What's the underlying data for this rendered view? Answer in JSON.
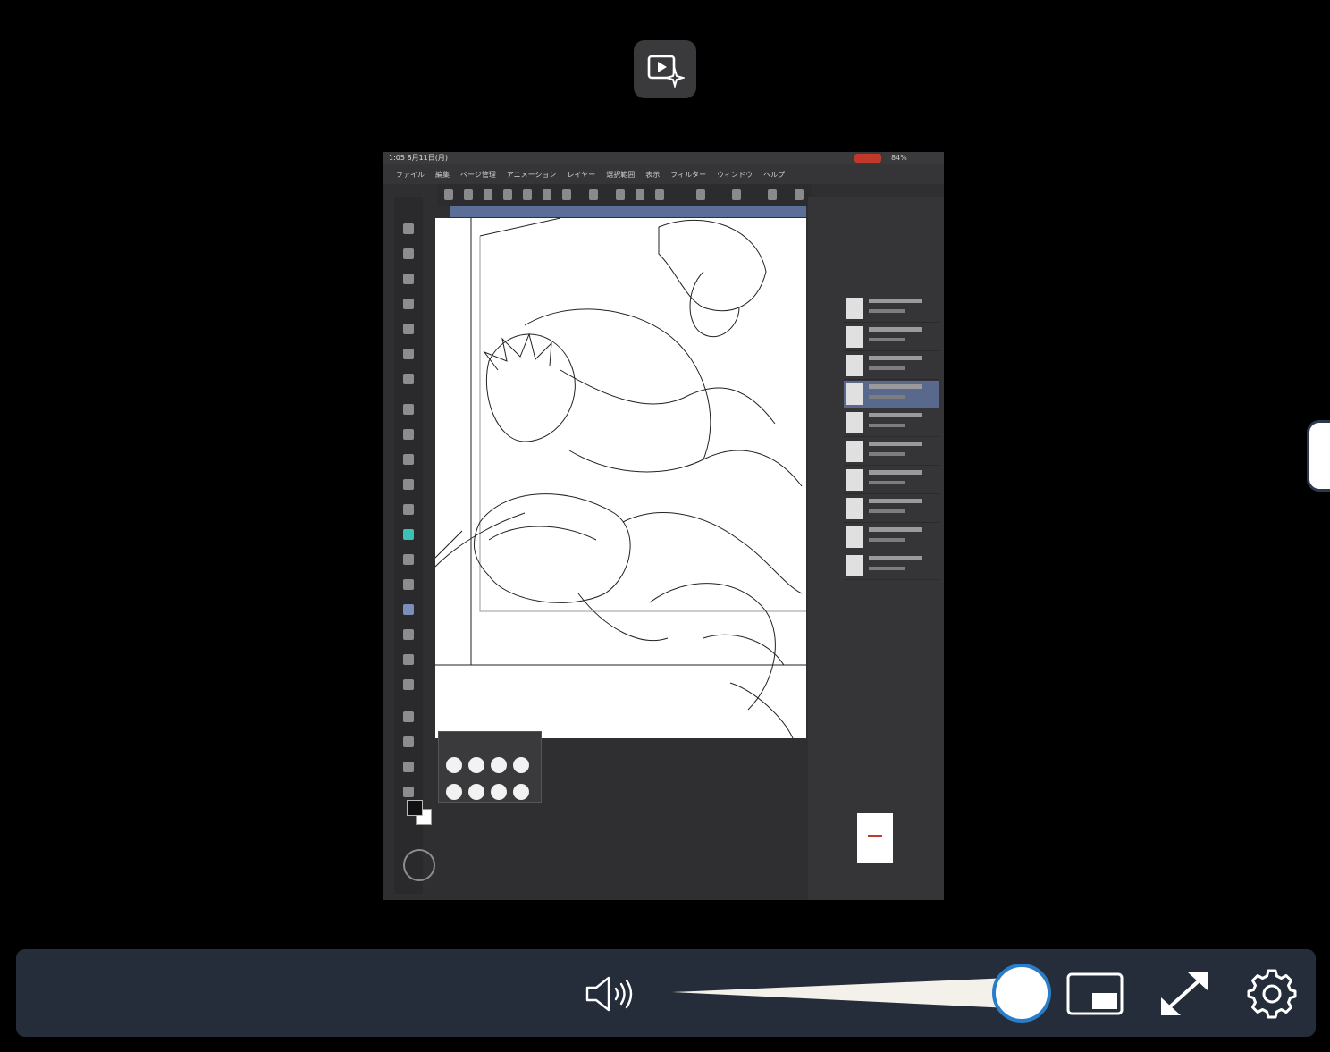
{
  "player": {
    "badge_icon": "ai-video-icon",
    "video": {
      "status_time": "1:05 8月11日(月)",
      "battery_text": "84%",
      "menu": [
        "ファイル",
        "編集",
        "ページ管理",
        "アニメーション",
        "レイヤー",
        "選択範囲",
        "表示",
        "フィルター",
        "ウィンドウ",
        "ヘルプ"
      ]
    },
    "controls": {
      "volume_icon": "speaker-icon",
      "volume_level": 1.0,
      "pip_icon": "picture-in-picture-icon",
      "fullscreen_icon": "fullscreen-icon",
      "settings_icon": "gear-icon"
    },
    "colors": {
      "bar_bg": "#262d3a",
      "knob_border": "#2a7dc9",
      "track_fill": "#f4f1ea"
    }
  }
}
